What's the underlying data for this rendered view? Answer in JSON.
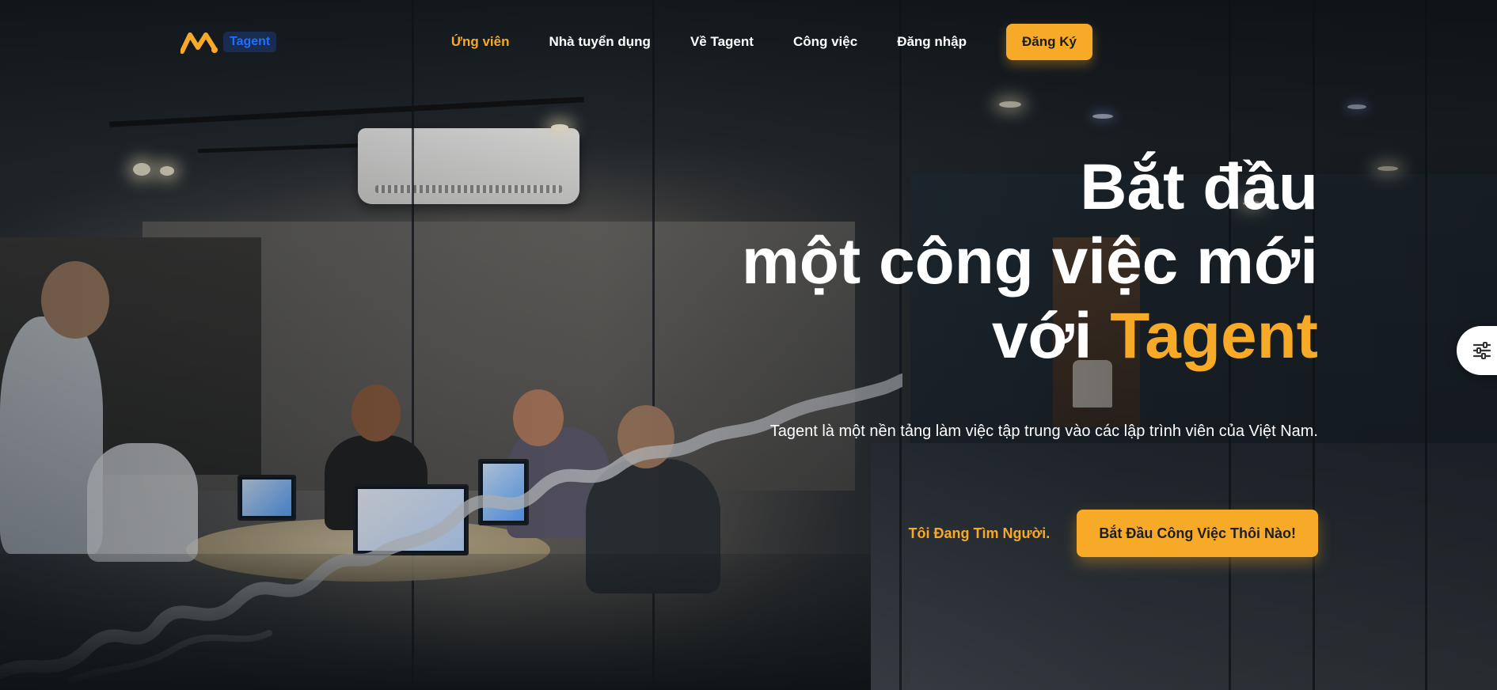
{
  "brand": {
    "logo_text": "Tagent",
    "logo_icon": "tagent-logo-mark",
    "accent_color": "#f7a928"
  },
  "nav": {
    "items": [
      {
        "label": "Ứng viên",
        "active": true
      },
      {
        "label": "Nhà tuyển dụng",
        "active": false
      },
      {
        "label": "Về Tagent",
        "active": false
      },
      {
        "label": "Công việc",
        "active": false
      },
      {
        "label": "Đăng nhập",
        "active": false
      }
    ],
    "signup_label": "Đăng Ký"
  },
  "hero": {
    "title_line1": "Bắt đầu",
    "title_line2": "một công việc mới",
    "title_line3_prefix": "với ",
    "title_line3_accent": "Tagent",
    "subtitle": "Tagent là một nền tảng làm việc tập trung vào các lập trình viên của Việt Nam.",
    "secondary_cta": "Tôi Đang Tìm Người.",
    "primary_cta": "Bắt Đầu Công Việc Thôi Nào!"
  },
  "side_panel": {
    "icon": "sliders-icon"
  }
}
